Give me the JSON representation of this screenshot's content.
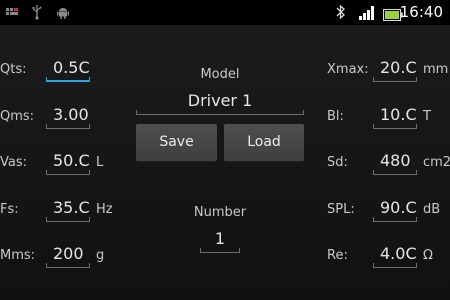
{
  "status_bar": {
    "time": "16:40",
    "left_icons": [
      "notification-icon",
      "usb-icon",
      "android-debug-icon"
    ],
    "right_icons": [
      "bluetooth-icon",
      "signal-icon",
      "battery-icon"
    ]
  },
  "left_params": [
    {
      "label": "Qts:",
      "value": "0.5C",
      "unit": ""
    },
    {
      "label": "Qms:",
      "value": "3.00",
      "unit": ""
    },
    {
      "label": "Vas:",
      "value": "50.C",
      "unit": "L"
    },
    {
      "label": "Fs:",
      "value": "35.C",
      "unit": "Hz"
    },
    {
      "label": "Mms:",
      "value": "200",
      "unit": "g"
    }
  ],
  "right_params": [
    {
      "label": "Xmax:",
      "value": "20.C",
      "unit": "mm"
    },
    {
      "label": "Bl:",
      "value": "10.C",
      "unit": "T"
    },
    {
      "label": "Sd:",
      "value": "480",
      "unit": "cm2"
    },
    {
      "label": "SPL:",
      "value": "90.C",
      "unit": "dB"
    },
    {
      "label": "Re:",
      "value": "4.0C",
      "unit": "Ω"
    }
  ],
  "model": {
    "label": "Model",
    "value": "Driver 1"
  },
  "buttons": {
    "save": "Save",
    "load": "Load"
  },
  "number": {
    "label": "Number",
    "value": "1"
  },
  "colors": {
    "accent": "#2aa5e0",
    "battery": "#9bd13a"
  }
}
